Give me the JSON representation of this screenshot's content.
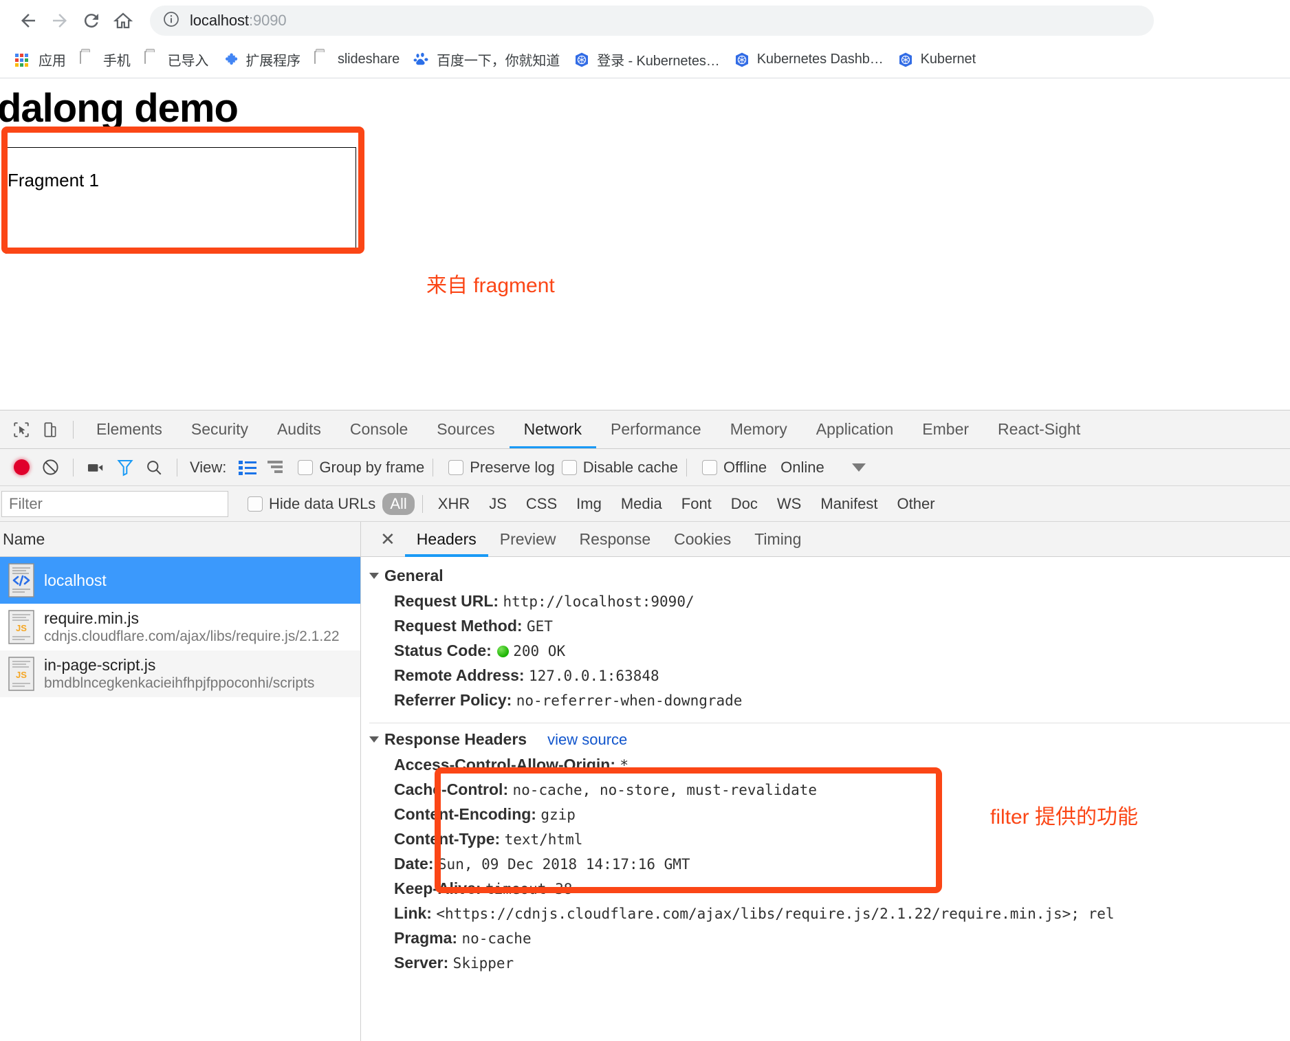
{
  "browser": {
    "nav": {
      "back": "back-arrow",
      "forward": "forward-arrow",
      "reload": "reload",
      "home": "home"
    },
    "omnibox": {
      "security_icon": "info-circle-icon",
      "host": "localhost",
      "port": ":9090",
      "full_url": "localhost:9090"
    },
    "bookmarks": [
      {
        "label": "应用",
        "icon": "apps-grid-icon"
      },
      {
        "label": "手机",
        "icon": "folder-icon"
      },
      {
        "label": "已导入",
        "icon": "folder-icon"
      },
      {
        "label": "扩展程序",
        "icon": "puzzle-piece-icon"
      },
      {
        "label": "slideshare",
        "icon": "folder-icon"
      },
      {
        "label": "百度一下，你就知道",
        "icon": "baidu-icon"
      },
      {
        "label": "登录 - Kubernetes…",
        "icon": "kubernetes-icon"
      },
      {
        "label": "Kubernetes Dashb…",
        "icon": "kubernetes-icon"
      },
      {
        "label": "Kubernet",
        "icon": "kubernetes-icon"
      }
    ]
  },
  "page": {
    "title": "dalong demo",
    "fragment_text": "Fragment 1",
    "annotation_fragment": "来自 fragment"
  },
  "devtools": {
    "tabs": [
      {
        "label": "Elements",
        "active": false
      },
      {
        "label": "Security",
        "active": false
      },
      {
        "label": "Audits",
        "active": false
      },
      {
        "label": "Console",
        "active": false
      },
      {
        "label": "Sources",
        "active": false
      },
      {
        "label": "Network",
        "active": true
      },
      {
        "label": "Performance",
        "active": false
      },
      {
        "label": "Memory",
        "active": false
      },
      {
        "label": "Application",
        "active": false
      },
      {
        "label": "Ember",
        "active": false
      },
      {
        "label": "React-Sight",
        "active": false
      }
    ],
    "network_toolbar": {
      "record_title": "record-button",
      "clear_title": "clear-button",
      "capture_screenshots": "camera-icon",
      "filter_toggle": "funnel-icon",
      "search": "search-icon",
      "view_label": "View:",
      "group_by_frame": "Group by frame",
      "preserve_log": "Preserve log",
      "disable_cache": "Disable cache",
      "offline": "Offline",
      "throttle_value": "Online"
    },
    "filter_bar": {
      "filter_placeholder": "Filter",
      "filter_value": "",
      "hide_data_urls": "Hide data URLs",
      "types": [
        {
          "label": "All",
          "selected": true
        },
        {
          "label": "XHR",
          "selected": false
        },
        {
          "label": "JS",
          "selected": false
        },
        {
          "label": "CSS",
          "selected": false
        },
        {
          "label": "Img",
          "selected": false
        },
        {
          "label": "Media",
          "selected": false
        },
        {
          "label": "Font",
          "selected": false
        },
        {
          "label": "Doc",
          "selected": false
        },
        {
          "label": "WS",
          "selected": false
        },
        {
          "label": "Manifest",
          "selected": false
        },
        {
          "label": "Other",
          "selected": false
        }
      ]
    },
    "request_list": {
      "column_header": "Name",
      "rows": [
        {
          "name": "localhost",
          "sub": "",
          "icon": "document-code-icon",
          "selected": true
        },
        {
          "name": "require.min.js",
          "sub": "cdnjs.cloudflare.com/ajax/libs/require.js/2.1.22",
          "icon": "js-file-icon",
          "selected": false
        },
        {
          "name": "in-page-script.js",
          "sub": "bmdblncegkenkacieihfhpjfppoconhi/scripts",
          "icon": "js-file-icon",
          "selected": false
        }
      ]
    },
    "detail": {
      "close_icon": "close-icon",
      "tabs": [
        {
          "label": "Headers",
          "active": true
        },
        {
          "label": "Preview",
          "active": false
        },
        {
          "label": "Response",
          "active": false
        },
        {
          "label": "Cookies",
          "active": false
        },
        {
          "label": "Timing",
          "active": false
        }
      ],
      "general": {
        "title": "General",
        "rows": [
          {
            "key": "Request URL:",
            "value": "http://localhost:9090/"
          },
          {
            "key": "Request Method:",
            "value": "GET"
          },
          {
            "key": "Status Code:",
            "value": "200 OK",
            "status_dot": "#19b200"
          },
          {
            "key": "Remote Address:",
            "value": "127.0.0.1:63848"
          },
          {
            "key": "Referrer Policy:",
            "value": "no-referrer-when-downgrade"
          }
        ]
      },
      "response_headers": {
        "title": "Response Headers",
        "view_source": "view source",
        "rows": [
          {
            "key": "Access-Control-Allow-Origin:",
            "value": "*"
          },
          {
            "key": "Cache-Control:",
            "value": "no-cache, no-store, must-revalidate"
          },
          {
            "key": "Content-Encoding:",
            "value": "gzip"
          },
          {
            "key": "Content-Type:",
            "value": "text/html"
          },
          {
            "key": "Date:",
            "value": "Sun, 09 Dec 2018 14:17:16 GMT"
          },
          {
            "key": "Keep-Alive:",
            "value": "timeout=38"
          },
          {
            "key": "Link:",
            "value": "<https://cdnjs.cloudflare.com/ajax/libs/require.js/2.1.22/require.min.js>; rel"
          },
          {
            "key": "Pragma:",
            "value": "no-cache"
          },
          {
            "key": "Server:",
            "value": "Skipper"
          }
        ]
      }
    },
    "annotation_filter": "filter 提供的功能"
  },
  "colors": {
    "annotation_orange": "#fb4616",
    "selection_blue": "#3b99fc",
    "tab_underline": "#1a9af5",
    "status_green": "#19b200"
  }
}
